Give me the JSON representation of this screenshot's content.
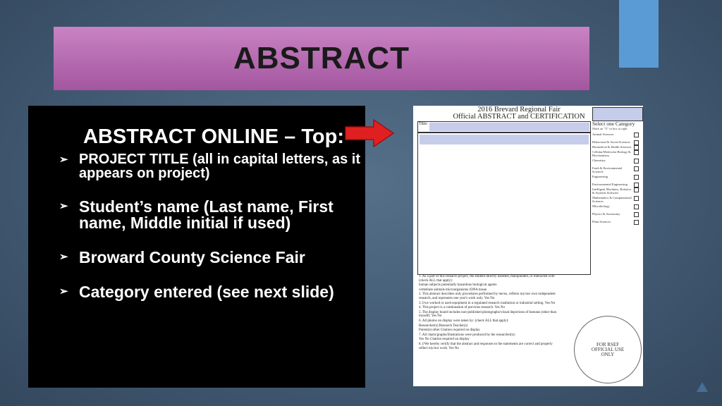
{
  "slide": {
    "title": "ABSTRACT",
    "accent_color": "#5b9bd5",
    "title_band_color": "#b86cb3"
  },
  "left_panel": {
    "heading": "ABSTRACT  ONLINE – Top:",
    "bullets": [
      {
        "text": "PROJECT TITLE (all in capital letters, as it appears on project)",
        "size": "small"
      },
      {
        "text": "Student’s name (Last name, First name, Middle initial if used)",
        "size": "big"
      },
      {
        "text": "Broward County Science Fair",
        "size": "big"
      },
      {
        "text": "Category entered (see next slide)",
        "size": "big"
      }
    ],
    "bullet_icon": "arrow-bullet-icon",
    "pointer_icon": "red-arrow-icon",
    "pointer_color": "#e02020"
  },
  "form": {
    "title_line1": "2016 Brevard Regional Fair",
    "title_line2": "Official ABSTRACT and CERTIFICATION",
    "title_label": "Title:",
    "category_heading": "Select one Category",
    "category_note": "Mark an \"X\" in box at right",
    "categories": [
      "Animal Sciences",
      "Behavioral & Social Sciences",
      "Biomedical & Health Sciences",
      "Cellular/Molecular Biology & Biochemistry",
      "Chemistry",
      "Earth & Environmental Sciences",
      "Engineering",
      "Environmental Engineering",
      "Intelligent Machines, Robotics & Systems Software",
      "Mathematics & Computational Sciences",
      "Microbiology",
      "Physics & Astronomy",
      "Plant Sciences"
    ],
    "statements": [
      "1. As a part of this research project, the student directly handled, manipulated, or interacted with (check ALL that apply):",
      "human subjects   potentially hazardous biological agents",
      "vertebrate animals   microorganisms   rDNA   tissue",
      "2. This abstract describes only procedures performed by me/us, reflects my/our own independent research, and represents one year's work only.  Yes  No",
      "3. I/we worked or used equipment in a regulated research institution or industrial setting.  Yes  No",
      "4. This project is a continuation of previous research.  Yes  No",
      "5. The display board includes non-published photographs/visual depictions of humans (other than myself):  Yes  No",
      "6. All photos on display were taken by: (check ALL that apply):",
      "Researcher(s)   Research Teacher(s)",
      "Parent(s)   other   Citation required on display",
      "7. All charts/graphs/illustrations were produced by the researcher(s):",
      "Yes   No   Citation required on display",
      "8. I/We hereby certify that the abstract and responses to the statements are correct and properly reflect my/our work.  Yes  No"
    ],
    "seal_text": "FOR RSEF OFFICIAL USE ONLY",
    "highlight_color": "#c5cdea"
  }
}
